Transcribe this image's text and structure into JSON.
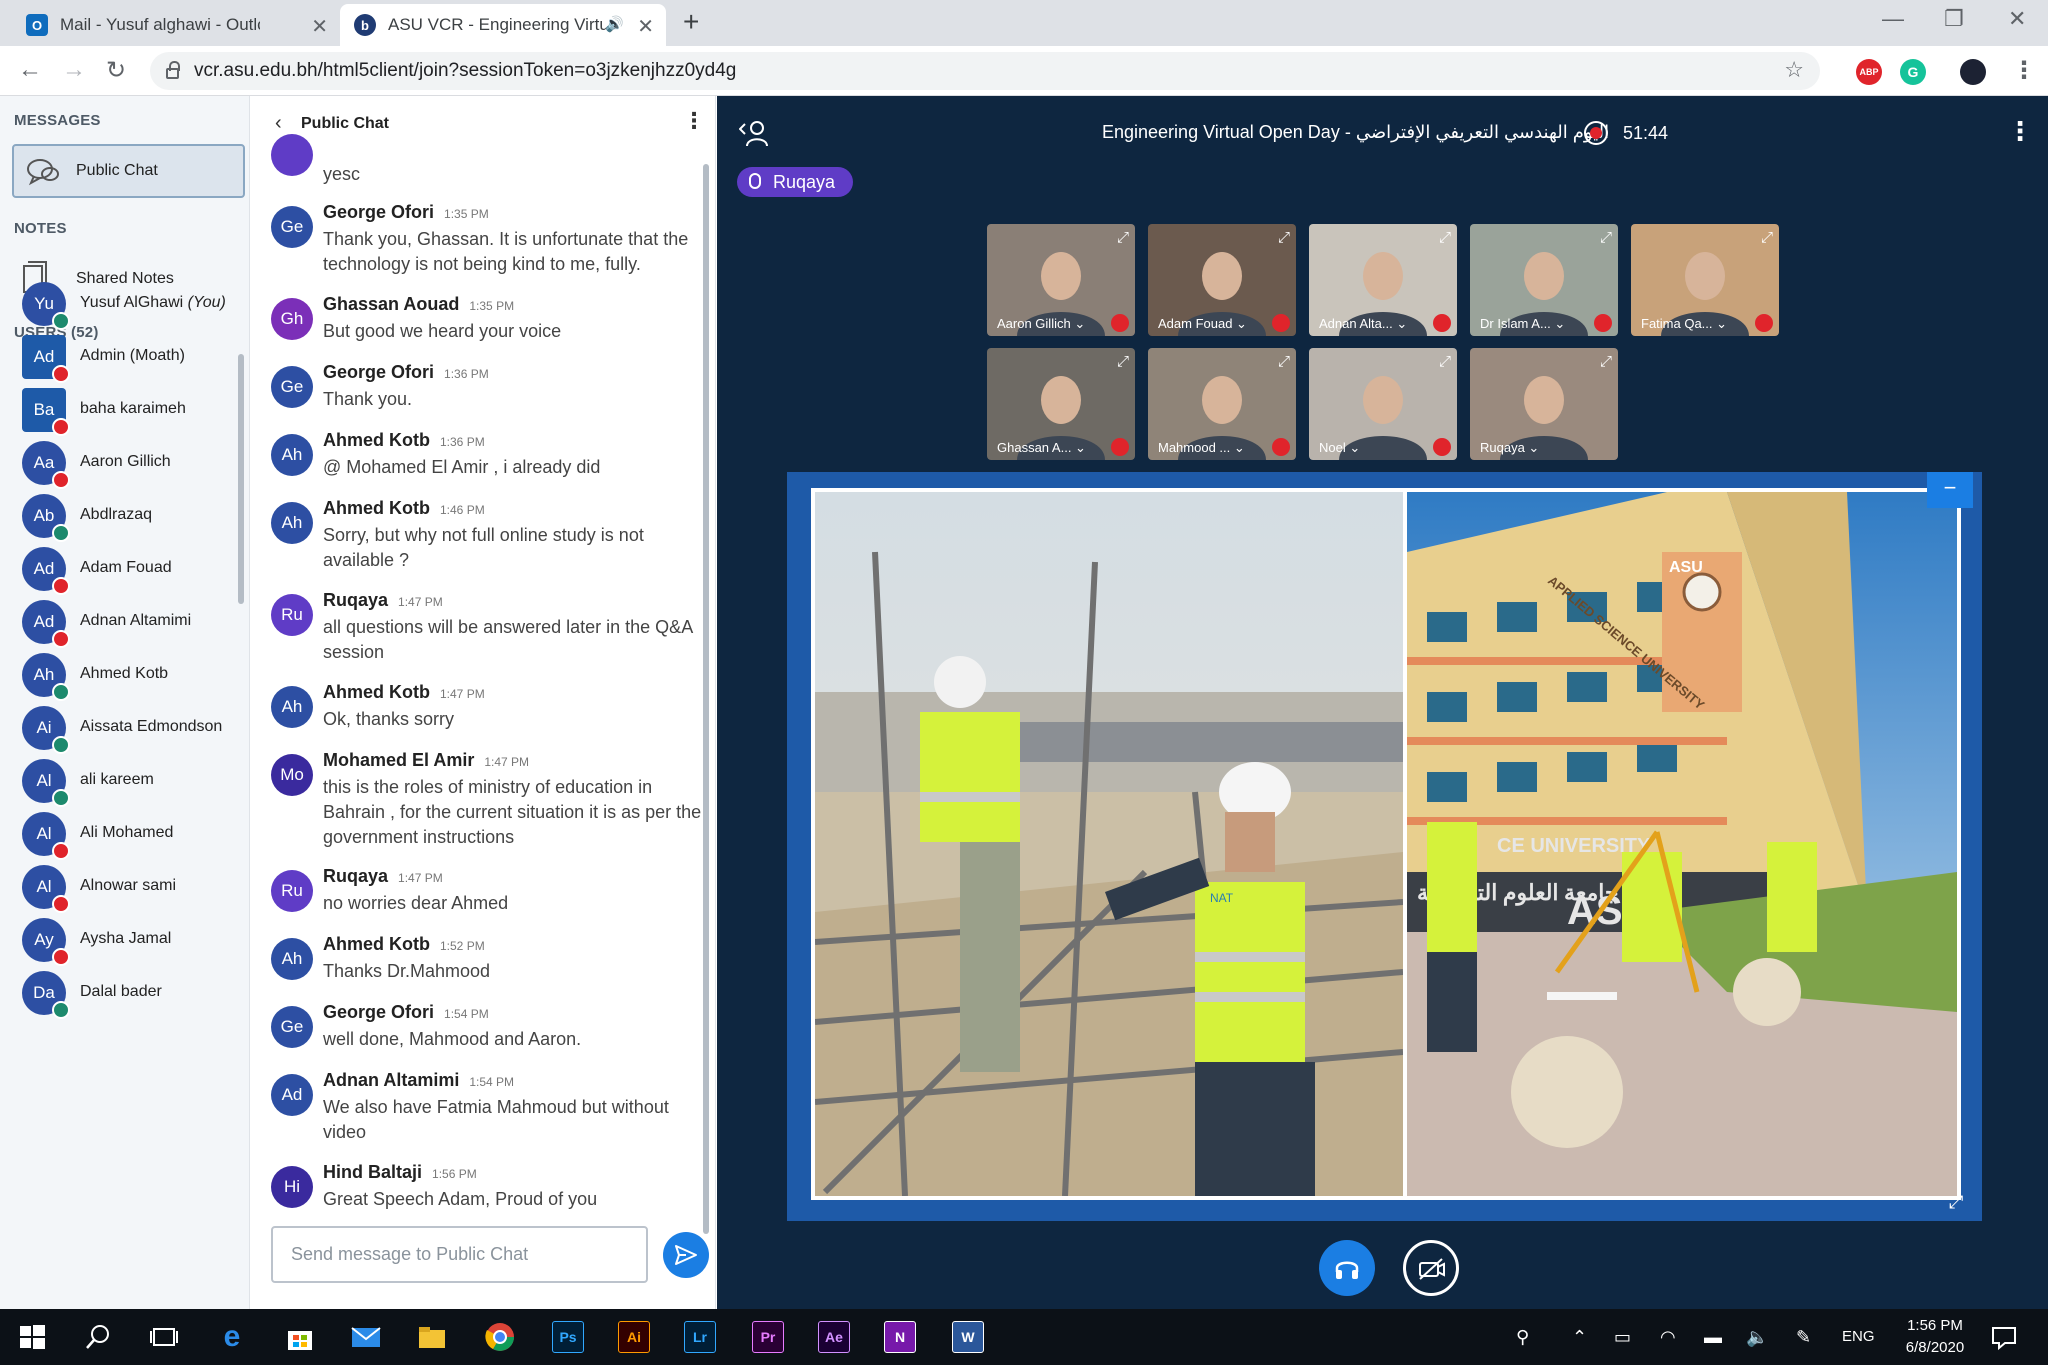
{
  "browser": {
    "tabs": [
      {
        "title": "Mail - Yusuf alghawi - Outlook",
        "active": false
      },
      {
        "title": "ASU VCR - Engineering Virtu",
        "active": true
      }
    ],
    "url": "vcr.asu.edu.bh/html5client/join?sessionToken=o3jzkenjhzz0yd4g",
    "extensions": [
      "ABP",
      "G"
    ]
  },
  "sidebar": {
    "messages_label": "MESSAGES",
    "public_chat_label": "Public Chat",
    "notes_label": "NOTES",
    "shared_notes_label": "Shared Notes",
    "users_label": "USERS (52)",
    "you_label": "(You)",
    "users": [
      {
        "initials": "Yu",
        "name": "Yusuf AlGhawi",
        "badge": "#1d8a6d",
        "mod": false
      },
      {
        "initials": "Ad",
        "name": "Admin (Moath)",
        "badge": "#e0242b",
        "mod": true
      },
      {
        "initials": "Ba",
        "name": "baha karaimeh",
        "badge": "#e0242b",
        "mod": true
      },
      {
        "initials": "Aa",
        "name": "Aaron Gillich",
        "badge": "#e0242b",
        "mod": false
      },
      {
        "initials": "Ab",
        "name": "Abdlrazaq",
        "badge": "#1d8a6d",
        "mod": false
      },
      {
        "initials": "Ad",
        "name": "Adam Fouad",
        "badge": "#e0242b",
        "mod": false
      },
      {
        "initials": "Ad",
        "name": "Adnan Altamimi",
        "badge": "#e0242b",
        "mod": false
      },
      {
        "initials": "Ah",
        "name": "Ahmed Kotb",
        "badge": "#1d8a6d",
        "mod": false
      },
      {
        "initials": "Ai",
        "name": "Aissata Edmondson",
        "badge": "#1d8a6d",
        "mod": false
      },
      {
        "initials": "Al",
        "name": "ali kareem",
        "badge": "#1d8a6d",
        "mod": false
      },
      {
        "initials": "Al",
        "name": "Ali Mohamed",
        "badge": "#e0242b",
        "mod": false
      },
      {
        "initials": "Al",
        "name": "Alnowar sami",
        "badge": "#e0242b",
        "mod": false
      },
      {
        "initials": "Ay",
        "name": "Aysha Jamal",
        "badge": "#e0242b",
        "mod": false
      },
      {
        "initials": "Da",
        "name": "Dalal bader",
        "badge": "#1d8a6d",
        "mod": false
      }
    ]
  },
  "chat": {
    "title": "Public Chat",
    "partial_message": "yesc",
    "input_placeholder": "Send message to Public Chat",
    "messages": [
      {
        "initials": "Ge",
        "color": "#2d4fa3",
        "author": "George Ofori",
        "time": "1:35 PM",
        "text": "Thank you, Ghassan. It is unfortunate that the technology is not being kind to me, fully."
      },
      {
        "initials": "Gh",
        "color": "#7b2fb8",
        "author": "Ghassan Aouad",
        "time": "1:35 PM",
        "text": "But good we heard your voice"
      },
      {
        "initials": "Ge",
        "color": "#2d4fa3",
        "author": "George Ofori",
        "time": "1:36 PM",
        "text": "Thank you."
      },
      {
        "initials": "Ah",
        "color": "#2d4fa3",
        "author": "Ahmed Kotb",
        "time": "1:36 PM",
        "text": "@ Mohamed El Amir , i already did"
      },
      {
        "initials": "Ah",
        "color": "#2d4fa3",
        "author": "Ahmed Kotb",
        "time": "1:46 PM",
        "text": "Sorry, but why not full online study is not available ?"
      },
      {
        "initials": "Ru",
        "color": "#5f3cc6",
        "author": "Ruqaya",
        "time": "1:47 PM",
        "text": "all questions will be answered later in the Q&A session"
      },
      {
        "initials": "Ah",
        "color": "#2d4fa3",
        "author": "Ahmed Kotb",
        "time": "1:47 PM",
        "text": "Ok, thanks sorry"
      },
      {
        "initials": "Mo",
        "color": "#3a2a9e",
        "author": "Mohamed El Amir",
        "time": "1:47 PM",
        "text": "this is the roles of ministry of education in Bahrain , for the current situation it is as per the government instructions"
      },
      {
        "initials": "Ru",
        "color": "#5f3cc6",
        "author": "Ruqaya",
        "time": "1:47 PM",
        "text": "no worries dear Ahmed"
      },
      {
        "initials": "Ah",
        "color": "#2d4fa3",
        "author": "Ahmed Kotb",
        "time": "1:52 PM",
        "text": "Thanks Dr.Mahmood"
      },
      {
        "initials": "Ge",
        "color": "#2d4fa3",
        "author": "George Ofori",
        "time": "1:54 PM",
        "text": "well done, Mahmood and Aaron."
      },
      {
        "initials": "Ad",
        "color": "#2d4fa3",
        "author": "Adnan Altamimi",
        "time": "1:54 PM",
        "text": "We also have Fatmia Mahmoud but without video"
      },
      {
        "initials": "Hi",
        "color": "#3a2a9e",
        "author": "Hind Baltaji",
        "time": "1:56 PM",
        "text": "Great Speech Adam, Proud of you"
      }
    ]
  },
  "meeting": {
    "title": "Engineering Virtual Open Day - اليوم الهندسي التعريفي الإفتراضي",
    "recording_time": "51:44",
    "talking": "Ruqaya",
    "videos": [
      {
        "name": "Aaron Gillich",
        "muted": true,
        "bg": "#8a7f76"
      },
      {
        "name": "Adam Fouad",
        "muted": true,
        "bg": "#6b5a4e"
      },
      {
        "name": "Adnan Alta...",
        "muted": true,
        "bg": "#c9c4bb"
      },
      {
        "name": "Dr Islam A...",
        "muted": true,
        "bg": "#9aa39a"
      },
      {
        "name": "Fatima Qa...",
        "muted": true,
        "bg": "#c8a27a"
      },
      {
        "name": "Ghassan A...",
        "muted": true,
        "bg": "#6e6a64"
      },
      {
        "name": "Mahmood ...",
        "muted": true,
        "bg": "#8f8478"
      },
      {
        "name": "Noel",
        "muted": true,
        "bg": "#b9b3ac"
      },
      {
        "name": "Ruqaya",
        "muted": false,
        "bg": "#9a8a7e"
      }
    ],
    "slide_text": {
      "sign_left": "جامعة العلوم التطبيقية",
      "sign_right": "ASU",
      "sign_univ": "CE UNIVERSITY",
      "tower": "ASU",
      "banner": "APPLIED SCIENCE UNIVERSITY",
      "vest": "NAT"
    }
  },
  "taskbar": {
    "apps": [
      {
        "label": "Ps",
        "fg": "#31a8ff",
        "bg": "#001e36"
      },
      {
        "label": "Ai",
        "fg": "#ff9a00",
        "bg": "#330000"
      },
      {
        "label": "Lr",
        "fg": "#31a8ff",
        "bg": "#001e36"
      },
      {
        "label": "Pr",
        "fg": "#e77cff",
        "bg": "#2a0034"
      },
      {
        "label": "Ae",
        "fg": "#d291ff",
        "bg": "#1a0033"
      },
      {
        "label": "N",
        "fg": "#fff",
        "bg": "#7719aa"
      },
      {
        "label": "W",
        "fg": "#fff",
        "bg": "#2b579a"
      }
    ],
    "language": "ENG",
    "time": "1:56 PM",
    "date": "6/8/2020"
  }
}
